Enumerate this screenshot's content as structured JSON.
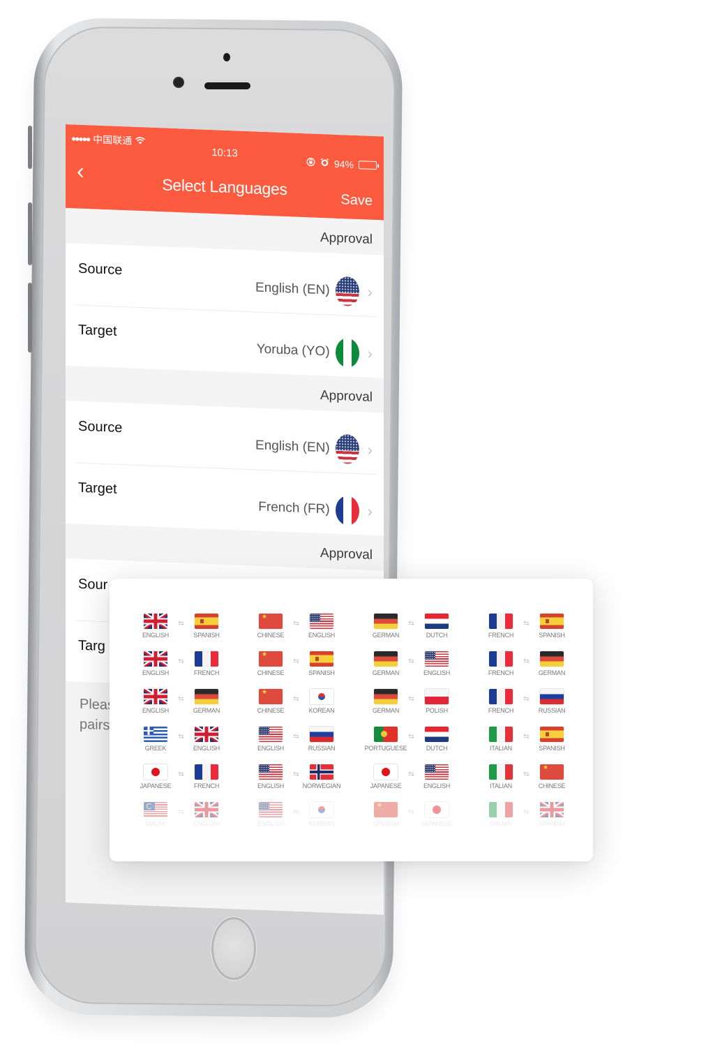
{
  "status_bar": {
    "signal": "●●●●●",
    "carrier": "中国联通",
    "wifi_icon": "wifi-icon",
    "time": "10:13",
    "lock_icon": "orientation-lock-icon",
    "alarm_icon": "alarm-icon",
    "battery_percent": "94%",
    "battery_level": 0.94
  },
  "nav": {
    "back_glyph": "‹",
    "title": "Select Languages",
    "save_label": "Save"
  },
  "sections": [
    {
      "header": "Approval",
      "rows": [
        {
          "label": "Source",
          "value": "English (EN)",
          "flag": "us"
        },
        {
          "label": "Target",
          "value": "Yoruba (YO)",
          "flag": "ng"
        }
      ]
    },
    {
      "header": "Approval",
      "rows": [
        {
          "label": "Source",
          "value": "English (EN)",
          "flag": "us"
        },
        {
          "label": "Target",
          "value": "French (FR)",
          "flag": "fr"
        }
      ]
    },
    {
      "header": "Approval",
      "rows": [
        {
          "label": "Sour",
          "value": "",
          "flag": ""
        },
        {
          "label": "Targ",
          "value": "",
          "flag": ""
        }
      ]
    }
  ],
  "footer_note": {
    "line1": "Pleas",
    "line2": "pairs"
  },
  "chevron_glyph": "›",
  "pairs_card": {
    "swap_glyph": "⇆",
    "rows": [
      [
        {
          "from": "ENGLISH",
          "from_flag": "uk",
          "to": "SPANISH",
          "to_flag": "es"
        },
        {
          "from": "CHINESE",
          "from_flag": "cn",
          "to": "ENGLISH",
          "to_flag": "us"
        },
        {
          "from": "GERMAN",
          "from_flag": "de",
          "to": "DUTCH",
          "to_flag": "nl"
        },
        {
          "from": "FRENCH",
          "from_flag": "fr",
          "to": "SPANISH",
          "to_flag": "es"
        }
      ],
      [
        {
          "from": "ENGLISH",
          "from_flag": "uk",
          "to": "FRENCH",
          "to_flag": "fr"
        },
        {
          "from": "CHINESE",
          "from_flag": "cn",
          "to": "SPANISH",
          "to_flag": "es"
        },
        {
          "from": "GERMAN",
          "from_flag": "de",
          "to": "ENGLISH",
          "to_flag": "us"
        },
        {
          "from": "FRENCH",
          "from_flag": "fr",
          "to": "GERMAN",
          "to_flag": "de"
        }
      ],
      [
        {
          "from": "ENGLISH",
          "from_flag": "uk",
          "to": "GERMAN",
          "to_flag": "de"
        },
        {
          "from": "CHINESE",
          "from_flag": "cn",
          "to": "KOREAN",
          "to_flag": "kr"
        },
        {
          "from": "GERMAN",
          "from_flag": "de",
          "to": "POLISH",
          "to_flag": "pl"
        },
        {
          "from": "FRENCH",
          "from_flag": "fr",
          "to": "RUSSIAN",
          "to_flag": "ru"
        }
      ],
      [
        {
          "from": "GREEK",
          "from_flag": "gr",
          "to": "ENGLISH",
          "to_flag": "uk"
        },
        {
          "from": "ENGLISH",
          "from_flag": "us",
          "to": "RUSSIAN",
          "to_flag": "ru"
        },
        {
          "from": "PORTUGUESE",
          "from_flag": "pt",
          "to": "DUTCH",
          "to_flag": "nl"
        },
        {
          "from": "ITALIAN",
          "from_flag": "it",
          "to": "SPANISH",
          "to_flag": "es"
        }
      ],
      [
        {
          "from": "JAPANESE",
          "from_flag": "jp",
          "to": "FRENCH",
          "to_flag": "fr"
        },
        {
          "from": "ENGLISH",
          "from_flag": "us",
          "to": "NORWEGIAN",
          "to_flag": "no"
        },
        {
          "from": "JAPANESE",
          "from_flag": "jp",
          "to": "ENGLISH",
          "to_flag": "us"
        },
        {
          "from": "ITALIAN",
          "from_flag": "it",
          "to": "CHINESE",
          "to_flag": "cn"
        }
      ],
      [
        {
          "from": "MALAY",
          "from_flag": "my",
          "to": "ENGLISH",
          "to_flag": "uk"
        },
        {
          "from": "ENGLISH",
          "from_flag": "us",
          "to": "KOREAN",
          "to_flag": "kr"
        },
        {
          "from": "SPANISH",
          "from_flag": "cn",
          "to": "JAPANESE",
          "to_flag": "jp"
        },
        {
          "from": "ITALIAN",
          "from_flag": "it",
          "to": "SPANISH",
          "to_flag": "uk"
        }
      ]
    ]
  },
  "colors": {
    "accent": "#fd5b3f",
    "screen_bg": "#f2f2f2",
    "chevron": "#c2c2c2"
  }
}
